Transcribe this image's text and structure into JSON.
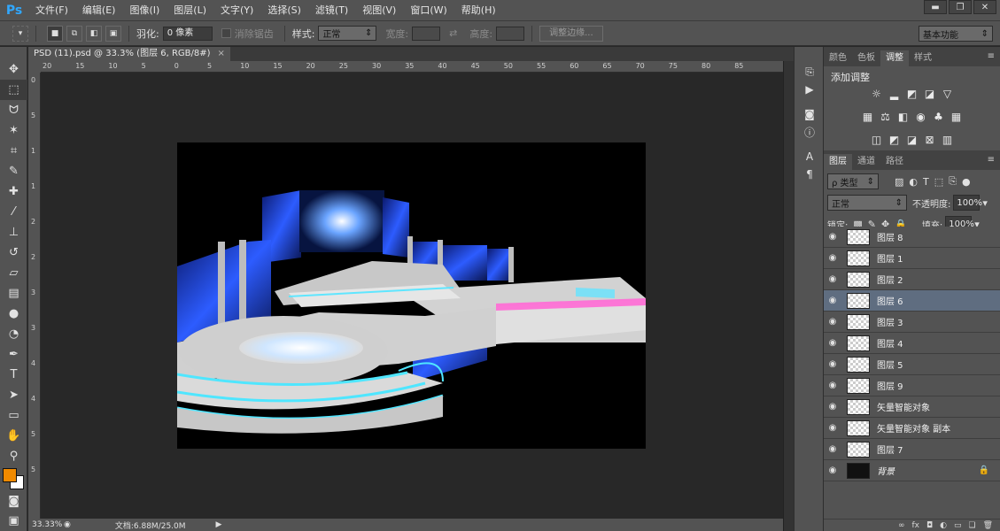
{
  "app": {
    "logo": "Ps"
  },
  "menu": [
    "文件(F)",
    "编辑(E)",
    "图像(I)",
    "图层(L)",
    "文字(Y)",
    "选择(S)",
    "滤镜(T)",
    "视图(V)",
    "窗口(W)",
    "帮助(H)"
  ],
  "window_controls": [
    "▬",
    "❐",
    "✕"
  ],
  "options": {
    "feather_label": "羽化:",
    "feather_value": "0 像素",
    "antialias_label": "消除锯齿",
    "style_label": "样式:",
    "style_value": "正常",
    "width_label": "宽度:",
    "height_label": "高度:",
    "refine_edge": "调整边缘...",
    "workspace": "基本功能"
  },
  "document": {
    "tab_title": "PSD (11).psd @ 33.3% (图层 6, RGB/8#)",
    "close": "×"
  },
  "ruler": {
    "h_ticks": [
      "20",
      "15",
      "10",
      "5",
      "0",
      "5",
      "10",
      "15",
      "20",
      "25",
      "30",
      "35",
      "40",
      "45",
      "50",
      "55",
      "60",
      "65",
      "70",
      "75",
      "80",
      "85"
    ],
    "v_ticks": [
      "0",
      "5",
      "1",
      "1",
      "2",
      "2",
      "3",
      "3",
      "4",
      "4",
      "5",
      "5"
    ]
  },
  "status": {
    "zoom": "33.33%",
    "doc_size": "文档:6.88M/25.0M"
  },
  "colors": {
    "foreground": "#f08a00",
    "background": "#ffffff"
  },
  "tools": [
    "move-tool",
    "marquee-tool",
    "lasso-tool",
    "magic-wand-tool",
    "crop-tool",
    "eyedropper-tool",
    "healing-tool",
    "brush-tool",
    "clone-stamp-tool",
    "history-brush-tool",
    "eraser-tool",
    "gradient-tool",
    "blur-tool",
    "dodge-tool",
    "pen-tool",
    "type-tool",
    "path-selection-tool",
    "shape-tool",
    "hand-tool",
    "zoom-tool"
  ],
  "panels": {
    "top_tabs": [
      "颜色",
      "色板",
      "调整",
      "样式"
    ],
    "adjust_title": "添加调整",
    "layer_tabs": [
      "图层",
      "通道",
      "路径"
    ],
    "filter_kind": "ρ 类型",
    "blend_mode": "正常",
    "opacity_label": "不透明度:",
    "opacity_value": "100%",
    "lock_label": "锁定:",
    "fill_label": "填充:",
    "fill_value": "100%"
  },
  "layers": [
    {
      "name": "图层 8",
      "selected": false,
      "italic": false
    },
    {
      "name": "图层 1",
      "selected": false,
      "italic": false
    },
    {
      "name": "图层 2",
      "selected": false,
      "italic": false
    },
    {
      "name": "图层 6",
      "selected": true,
      "italic": false
    },
    {
      "name": "图层 3",
      "selected": false,
      "italic": false
    },
    {
      "name": "图层 4",
      "selected": false,
      "italic": false
    },
    {
      "name": "图层 5",
      "selected": false,
      "italic": false
    },
    {
      "name": "图层 9",
      "selected": false,
      "italic": false
    },
    {
      "name": "矢量智能对象",
      "selected": false,
      "italic": false
    },
    {
      "name": "矢量智能对象 副本",
      "selected": false,
      "italic": false
    },
    {
      "name": "图层 7",
      "selected": false,
      "italic": false
    },
    {
      "name": "背景",
      "selected": false,
      "italic": true,
      "locked": true
    }
  ]
}
